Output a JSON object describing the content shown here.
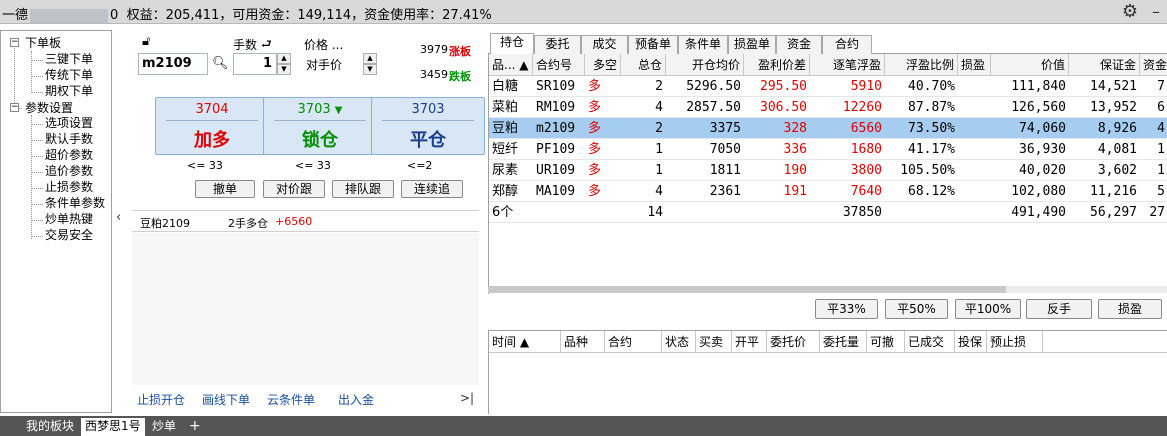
{
  "titlebar": {
    "prefix": "一德",
    "suffix": "0",
    "equity_label": "权益：",
    "equity": "205,411",
    "available_label": "，可用资金：",
    "available": "149,114",
    "usage_label": "，资金使用率：",
    "usage": "27.41%"
  },
  "tree": {
    "group1": "下单板",
    "group1_items": [
      "三键下单",
      "传统下单",
      "期权下单"
    ],
    "group2": "参数设置",
    "group2_items": [
      "选项设置",
      "默认手数",
      "超价参数",
      "追价参数",
      "止损参数",
      "条件单参数",
      "炒单热键",
      "交易安全"
    ]
  },
  "order": {
    "contract": "m2109",
    "qty_label": "手数",
    "qty": "1",
    "price_label": "价格 ...",
    "price_type": "对手价",
    "limit_up_price": "3979",
    "limit_up_label": "涨板",
    "limit_down_price": "3459",
    "limit_down_label": "跌板",
    "buy_price": "3704",
    "buy_label": "加多",
    "lock_price": "3703",
    "lock_label": "锁仓",
    "close_price": "3703",
    "close_label": "平仓",
    "buy_limit": "<= 33",
    "lock_limit": "<= 33",
    "close_limit": "<=2",
    "cancel": "撤单",
    "chase_counter": "对价跟",
    "chase_queue": "排队跟",
    "continuous_chase": "连续追"
  },
  "summary": {
    "name": "豆粕2109",
    "position": "2手多仓",
    "pnl": "+6560"
  },
  "links": [
    "止损开仓",
    "画线下单",
    "云条件单",
    "出入金"
  ],
  "links_more": ">|",
  "tabs": [
    "持仓",
    "委托",
    "成交",
    "预备单",
    "条件单",
    "损盈单",
    "资金",
    "合约"
  ],
  "positions": {
    "headers": [
      "品... ▲",
      "合约号",
      "多空",
      "总仓",
      "开仓均价",
      "盈利价差",
      "逐笔浮盈",
      "浮盈比例",
      "损盈",
      "价值",
      "保证金",
      "资金"
    ],
    "rows": [
      [
        "白糖",
        "SR109",
        "多",
        "2",
        "5296.50",
        "295.50",
        "5910",
        "40.70%",
        "",
        "111,840",
        "14,521",
        "7"
      ],
      [
        "菜粕",
        "RM109",
        "多",
        "4",
        "2857.50",
        "306.50",
        "12260",
        "87.87%",
        "",
        "126,560",
        "13,952",
        "6"
      ],
      [
        "豆粕",
        "m2109",
        "多",
        "2",
        "3375",
        "328",
        "6560",
        "73.50%",
        "",
        "74,060",
        "8,926",
        "4"
      ],
      [
        "短纤",
        "PF109",
        "多",
        "1",
        "7050",
        "336",
        "1680",
        "41.17%",
        "",
        "36,930",
        "4,081",
        "1"
      ],
      [
        "尿素",
        "UR109",
        "多",
        "1",
        "1811",
        "190",
        "3800",
        "105.50%",
        "",
        "40,020",
        "3,602",
        "1"
      ],
      [
        "郑醇",
        "MA109",
        "多",
        "4",
        "2361",
        "191",
        "7640",
        "68.12%",
        "",
        "102,080",
        "11,216",
        "5"
      ]
    ],
    "total": [
      "6个",
      "",
      "",
      "14",
      "",
      "",
      "37850",
      "",
      "",
      "491,490",
      "56,297",
      "27"
    ]
  },
  "actions": [
    "平33%",
    "平50%",
    "平100%",
    "反手",
    "损盈"
  ],
  "orders": {
    "headers": [
      "时间 ▲",
      "品种",
      "合约",
      "状态",
      "买卖",
      "开平",
      "委托价",
      "委托量",
      "可撤",
      "已成交",
      "投保",
      "预止损"
    ]
  },
  "bottom_tabs": [
    "我的板块",
    "西梦思1号",
    "炒单",
    "+"
  ],
  "colors": {
    "red": "#e00000",
    "green": "#009000",
    "selected_row": "#a6cdf0",
    "button_blue": "#d8e6f5"
  }
}
